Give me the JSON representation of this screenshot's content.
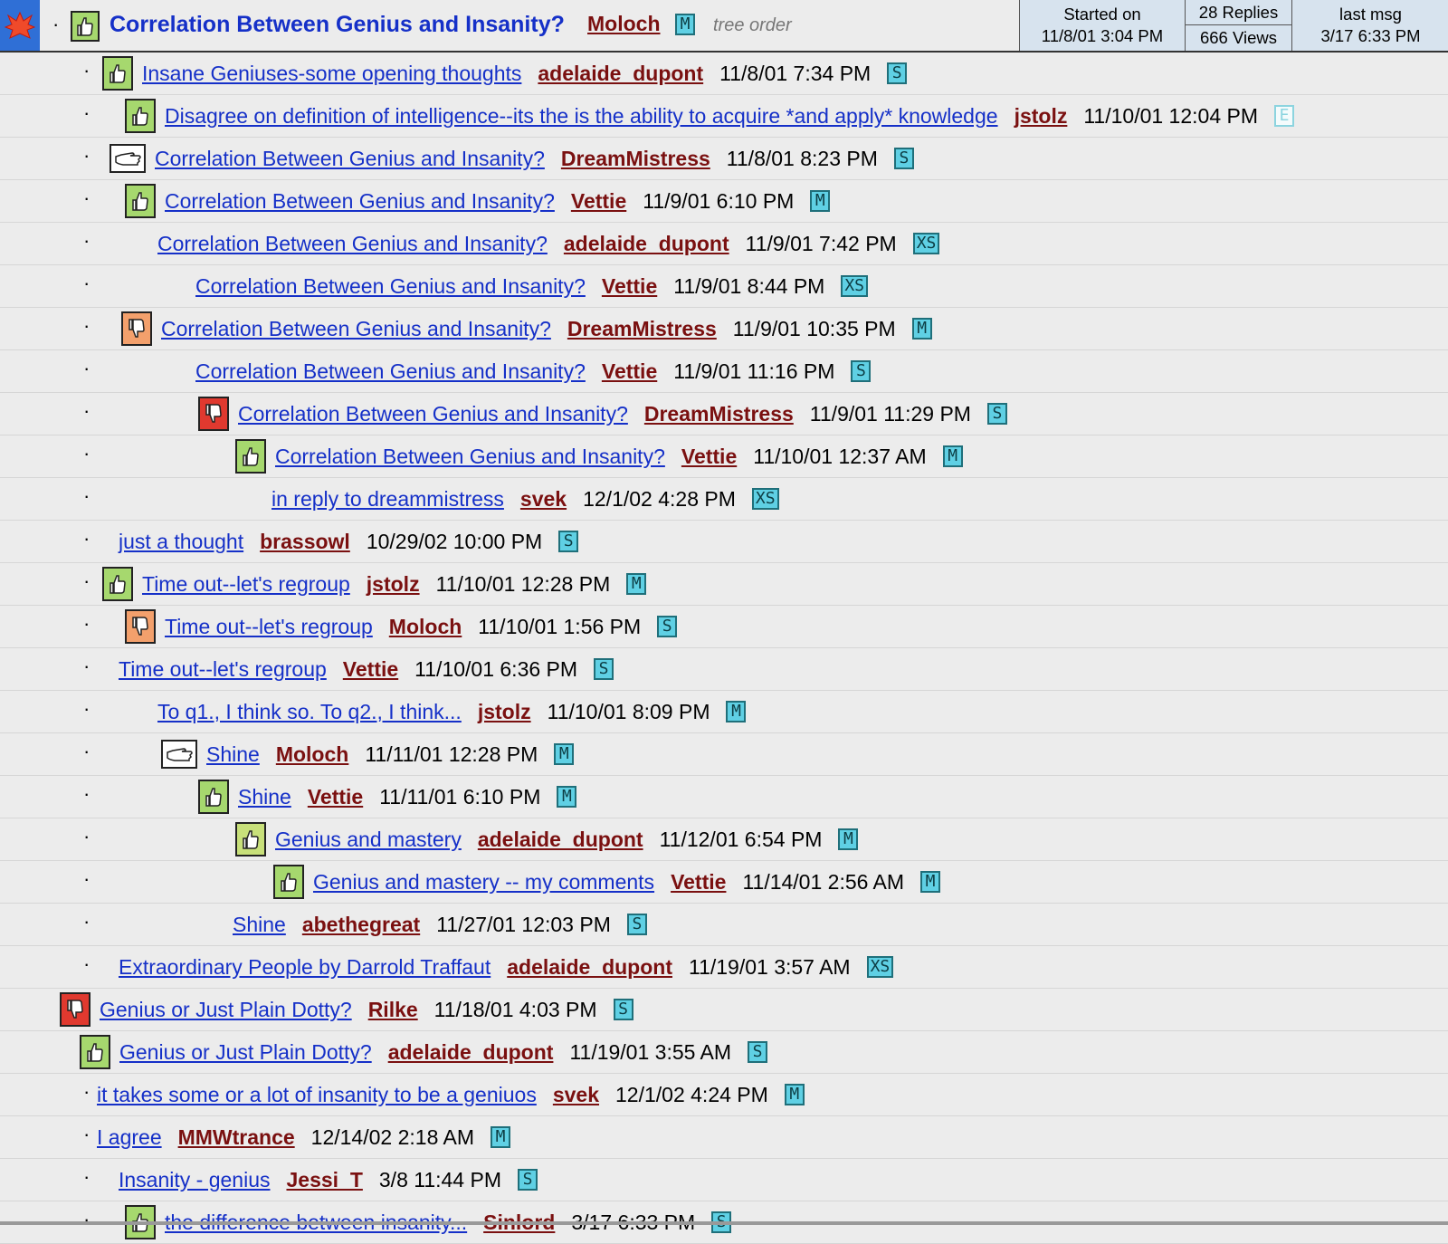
{
  "header": {
    "title": "Correlation Between Genius and Insanity?",
    "author": "Moloch",
    "badge": "M",
    "tree_order": "tree order",
    "started_label": "Started on",
    "started_date": "11/8/01 3:04 PM",
    "replies": "28 Replies",
    "views": "666 Views",
    "last_label": "last msg",
    "last_date": "3/17 6:33 PM"
  },
  "messages": [
    {
      "subject": "Insane Geniuses-some opening thoughts",
      "author": "adelaide_dupont",
      "date": "11/8/01 7:34 PM",
      "size": "S",
      "rating": "up-icon"
    },
    {
      "subject": "Disagree on definition of intelligence--its the is the ability to acquire *and apply* knowledge",
      "author": "jstolz",
      "date": "11/10/01 12:04 PM",
      "size": "E",
      "rating": "up-icon"
    },
    {
      "subject": "Correlation Between Genius and Insanity?",
      "author": "DreamMistress",
      "date": "11/8/01 8:23 PM",
      "size": "S",
      "rating": "flat-hand-icon"
    },
    {
      "subject": "Correlation Between Genius and Insanity?",
      "author": "Vettie",
      "date": "11/9/01 6:10 PM",
      "size": "M",
      "rating": "up-icon"
    },
    {
      "subject": "Correlation Between Genius and Insanity?",
      "author": "adelaide_dupont",
      "date": "11/9/01 7:42 PM",
      "size": "XS",
      "rating": ""
    },
    {
      "subject": "Correlation Between Genius and Insanity?",
      "author": "Vettie",
      "date": "11/9/01 8:44 PM",
      "size": "XS",
      "rating": ""
    },
    {
      "subject": "Correlation Between Genius and Insanity?",
      "author": "DreamMistress",
      "date": "11/9/01 10:35 PM",
      "size": "M",
      "rating": "down-icon"
    },
    {
      "subject": "Correlation Between Genius and Insanity?",
      "author": "Vettie",
      "date": "11/9/01 11:16 PM",
      "size": "S",
      "rating": ""
    },
    {
      "subject": "Correlation Between Genius and Insanity?",
      "author": "DreamMistress",
      "date": "11/9/01 11:29 PM",
      "size": "S",
      "rating": "bad-icon"
    },
    {
      "subject": "Correlation Between Genius and Insanity?",
      "author": "Vettie",
      "date": "11/10/01 12:37 AM",
      "size": "M",
      "rating": "up-icon"
    },
    {
      "subject": "in reply to dreammistress",
      "author": "svek",
      "date": "12/1/02 4:28 PM",
      "size": "XS",
      "rating": ""
    },
    {
      "subject": "just a thought",
      "author": "brassowl",
      "date": "10/29/02 10:00 PM",
      "size": "S",
      "rating": ""
    },
    {
      "subject": "Time out--let's regroup",
      "author": "jstolz",
      "date": "11/10/01 12:28 PM",
      "size": "M",
      "rating": "up-icon"
    },
    {
      "subject": "Time out--let's regroup",
      "author": "Moloch",
      "date": "11/10/01 1:56 PM",
      "size": "S",
      "rating": "down-icon"
    },
    {
      "subject": "Time out--let's regroup",
      "author": "Vettie",
      "date": "11/10/01 6:36 PM",
      "size": "S",
      "rating": ""
    },
    {
      "subject": "To q1., I think so.  To q2., I think...",
      "author": "jstolz",
      "date": "11/10/01 8:09 PM",
      "size": "M",
      "rating": ""
    },
    {
      "subject": "Shine",
      "author": "Moloch",
      "date": "11/11/01 12:28 PM",
      "size": "M",
      "rating": "flat-hand-icon"
    },
    {
      "subject": "Shine",
      "author": "Vettie",
      "date": "11/11/01 6:10 PM",
      "size": "M",
      "rating": "up-icon"
    },
    {
      "subject": "Genius and mastery",
      "author": "adelaide_dupont",
      "date": "11/12/01 6:54 PM",
      "size": "M",
      "rating": "up2-icon"
    },
    {
      "subject": "Genius and mastery -- my comments",
      "author": "Vettie",
      "date": "11/14/01 2:56 AM",
      "size": "M",
      "rating": "up-icon"
    },
    {
      "subject": "Shine",
      "author": "abethegreat",
      "date": "11/27/01 12:03 PM",
      "size": "S",
      "rating": ""
    },
    {
      "subject": "Extraordinary People by Darrold Traffaut",
      "author": "adelaide_dupont",
      "date": "11/19/01 3:57 AM",
      "size": "XS",
      "rating": ""
    },
    {
      "subject": "Genius or Just Plain Dotty?",
      "author": "Rilke",
      "date": "11/18/01 4:03 PM",
      "size": "S",
      "rating": "bad-icon"
    },
    {
      "subject": "Genius or Just Plain Dotty?",
      "author": "adelaide_dupont",
      "date": "11/19/01 3:55 AM",
      "size": "S",
      "rating": "up-icon"
    },
    {
      "subject": "it takes some or a lot of insanity to be a geniuos",
      "author": "svek",
      "date": "12/1/02 4:24 PM",
      "size": "M",
      "rating": ""
    },
    {
      "subject": "I agree",
      "author": "MMWtrance",
      "date": "12/14/02 2:18 AM",
      "size": "M",
      "rating": ""
    },
    {
      "subject": "Insanity - genius",
      "author": "Jessi_T",
      "date": "3/8 11:44 PM",
      "size": "S",
      "rating": ""
    },
    {
      "subject": "the difference between insanity...",
      "author": "Sinlord",
      "date": "3/17 6:33 PM",
      "size": "S",
      "rating": "up-icon"
    }
  ]
}
